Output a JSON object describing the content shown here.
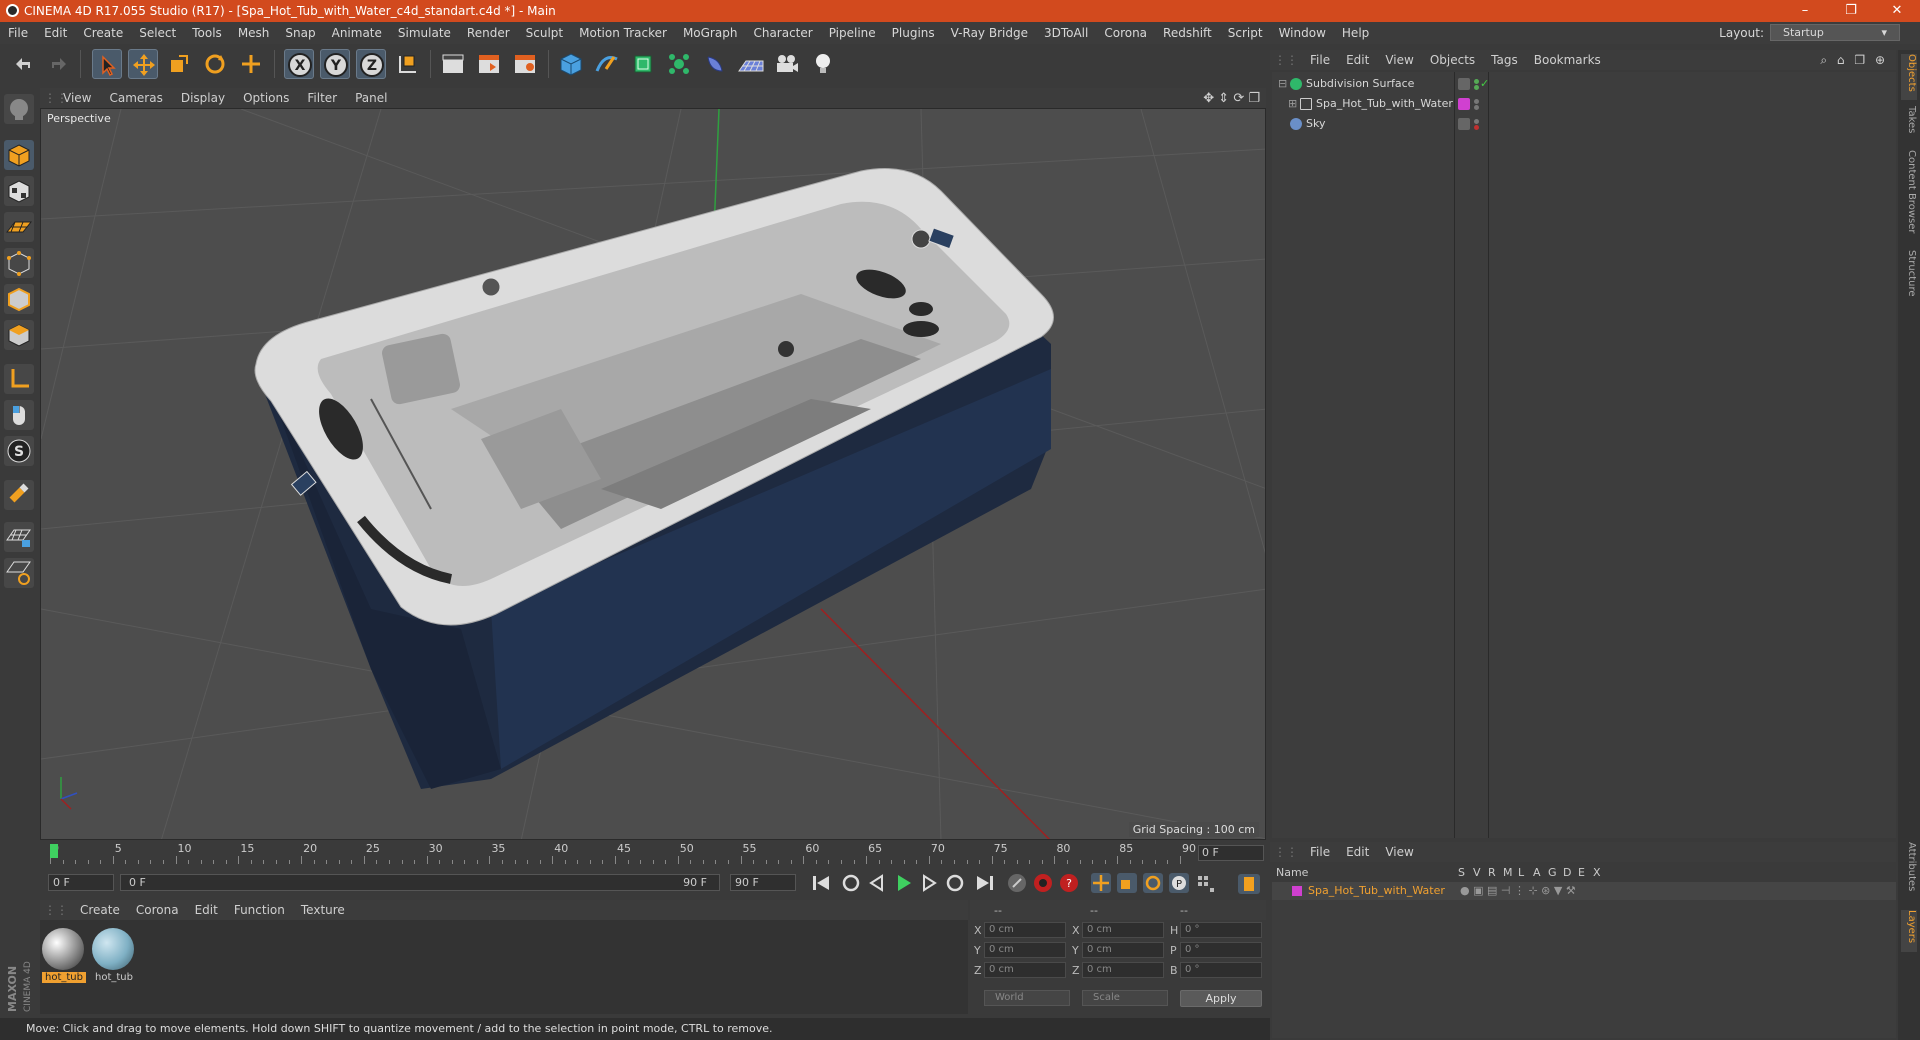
{
  "window": {
    "title": "CINEMA 4D R17.055 Studio (R17) - [Spa_Hot_Tub_with_Water_c4d_standart.c4d *] - Main",
    "minimize": "–",
    "maximize": "❐",
    "close": "✕"
  },
  "menubar": {
    "items": [
      "File",
      "Edit",
      "Create",
      "Select",
      "Tools",
      "Mesh",
      "Snap",
      "Animate",
      "Simulate",
      "Render",
      "Sculpt",
      "Motion Tracker",
      "MoGraph",
      "Character",
      "Pipeline",
      "Plugins",
      "V-Ray Bridge",
      "3DToAll",
      "Corona",
      "Redshift",
      "Script",
      "Window",
      "Help"
    ],
    "layout_label": "Layout:",
    "layout_value": "Startup"
  },
  "toolbar": {
    "axis_x": "X",
    "axis_y": "Y",
    "axis_z": "Z"
  },
  "viewport": {
    "menu": [
      "View",
      "Cameras",
      "Display",
      "Options",
      "Filter",
      "Panel"
    ],
    "camera_label": "Perspective",
    "grid_spacing": "Grid Spacing : 100 cm"
  },
  "timeline": {
    "ticks": [
      "0",
      "5",
      "10",
      "15",
      "20",
      "25",
      "30",
      "35",
      "40",
      "45",
      "50",
      "55",
      "60",
      "65",
      "70",
      "75",
      "80",
      "85",
      "90"
    ],
    "current_frame": "0 F",
    "start_field": "0 F",
    "range_start": "0 F",
    "range_end": "90 F",
    "end_field": "90 F"
  },
  "material_manager": {
    "menu": [
      "Create",
      "Corona",
      "Edit",
      "Function",
      "Texture"
    ],
    "materials": [
      {
        "name": "hot_tub",
        "selected": true
      },
      {
        "name": "hot_tub",
        "selected": false
      }
    ]
  },
  "coordinates": {
    "header": [
      "--",
      "--",
      "--"
    ],
    "rows": [
      {
        "a": "X",
        "av": "0 cm",
        "b": "X",
        "bv": "0 cm",
        "c": "H",
        "cv": "0 °"
      },
      {
        "a": "Y",
        "av": "0 cm",
        "b": "Y",
        "bv": "0 cm",
        "c": "P",
        "cv": "0 °"
      },
      {
        "a": "Z",
        "av": "0 cm",
        "b": "Z",
        "bv": "0 cm",
        "c": "B",
        "cv": "0 °"
      }
    ],
    "mode1": "World",
    "mode2": "Scale",
    "apply": "Apply"
  },
  "object_manager": {
    "menu": [
      "File",
      "Edit",
      "View",
      "Objects",
      "Tags",
      "Bookmarks"
    ],
    "objects": [
      {
        "name": "Subdivision Surface",
        "color": "#2fb86a"
      },
      {
        "name": "Spa_Hot_Tub_with_Water",
        "color": "#9a9a9a",
        "tag_color": "#d040d0"
      },
      {
        "name": "Sky",
        "color": "#6a8fc8"
      }
    ]
  },
  "layer_manager": {
    "menu": [
      "File",
      "Edit",
      "View"
    ],
    "columns": [
      "Name",
      "S",
      "V",
      "R",
      "M",
      "L",
      "A",
      "G",
      "D",
      "E",
      "X"
    ],
    "layer": {
      "name": "Spa_Hot_Tub_with_Water",
      "color": "#d040d0"
    }
  },
  "side_tabs": [
    "Objects",
    "Takes",
    "Content Browser",
    "Structure",
    "Attributes",
    "Layers"
  ],
  "status": "Move: Click and drag to move elements. Hold down SHIFT to quantize movement / add to the selection in point mode, CTRL to remove.",
  "brand": {
    "line1": "MAXON",
    "line2": "CINEMA 4D"
  },
  "colors": {
    "accent": "#d24a1e",
    "selection": "#f0a030"
  }
}
